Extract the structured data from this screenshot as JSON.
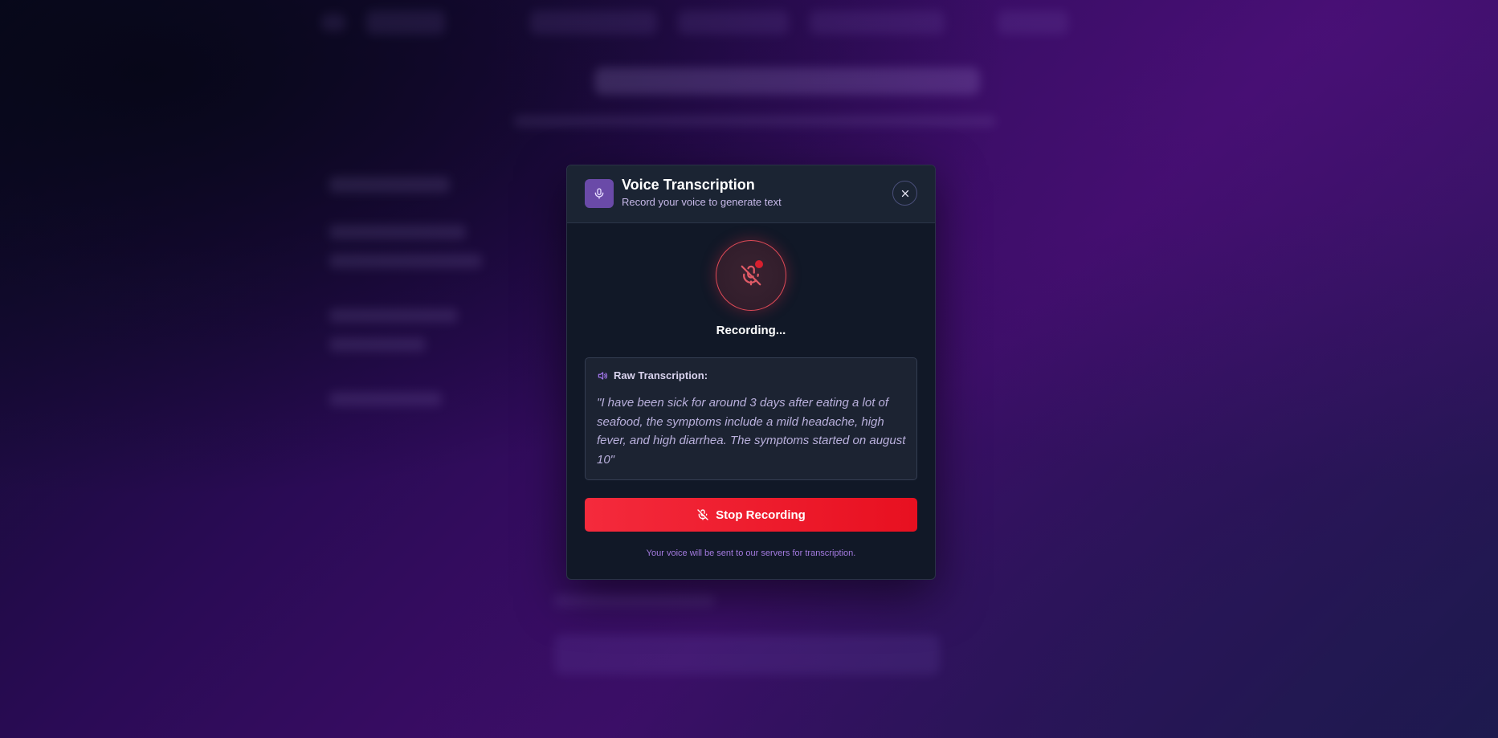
{
  "modal": {
    "title": "Voice Transcription",
    "subtitle": "Record your voice to generate text",
    "close_icon": "close-icon",
    "header_icon": "microphone-icon",
    "status": "Recording...",
    "recording_indicator_icon": "microphone-off-icon",
    "transcript_label": "Raw Transcription:",
    "transcript_icon": "speaker-icon",
    "transcript_text": "\"I have been sick for around 3 days after eating a lot of seafood, the symptoms include a mild headache, high fever, and high diarrhea. The symptoms started on august 10\"",
    "stop_button_label": "Stop Recording",
    "stop_button_icon": "microphone-off-icon",
    "footer_note": "Your voice will be sent to our servers for transcription."
  },
  "colors": {
    "accent_purple": "#6a4aa8",
    "recording_red": "#e81020",
    "modal_bg": "#111827",
    "footer_text": "#a47be0"
  }
}
